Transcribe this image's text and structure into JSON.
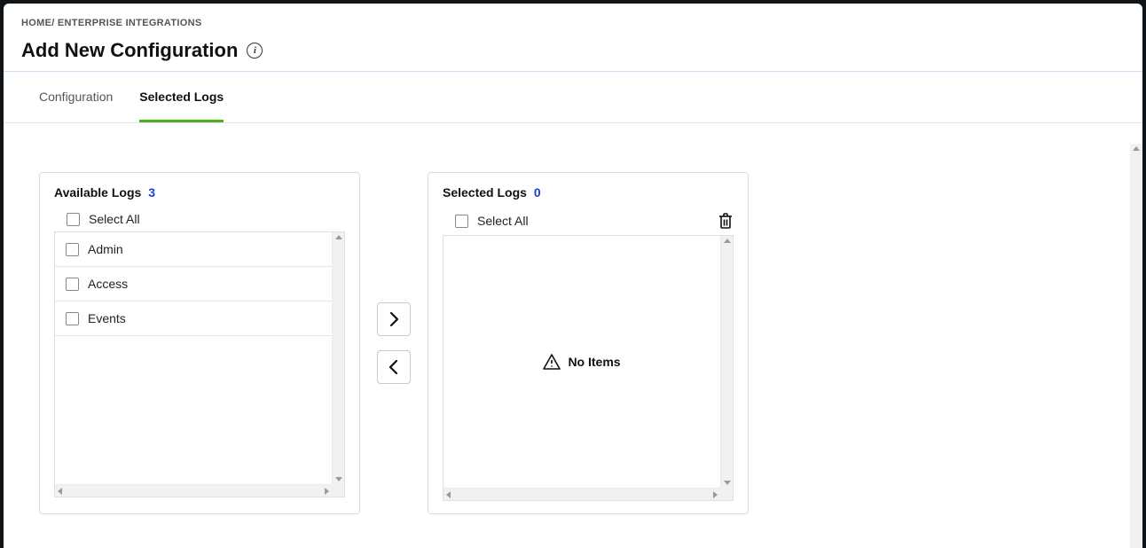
{
  "breadcrumb": {
    "home": "HOME",
    "sep": "/",
    "current": "ENTERPRISE INTEGRATIONS"
  },
  "page": {
    "title": "Add New Configuration"
  },
  "tabs": {
    "configuration": "Configuration",
    "selected_logs": "Selected Logs"
  },
  "available": {
    "title": "Available Logs",
    "count": "3",
    "select_all": "Select All",
    "items": {
      "0": "Admin",
      "1": "Access",
      "2": "Events"
    }
  },
  "selected": {
    "title": "Selected Logs",
    "count": "0",
    "select_all": "Select All",
    "empty": "No Items"
  }
}
